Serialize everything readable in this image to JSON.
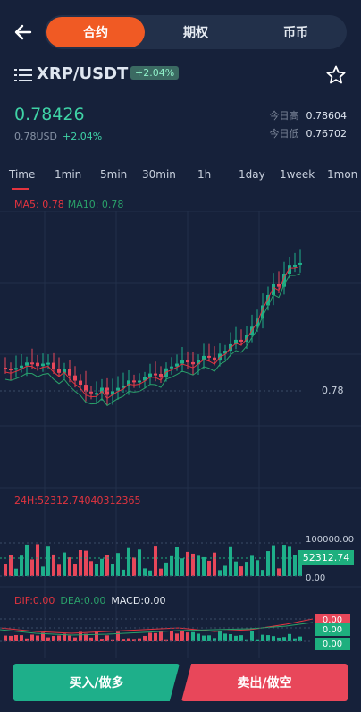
{
  "header": {
    "tabs": [
      {
        "label": "合约",
        "active": true
      },
      {
        "label": "期权",
        "active": false
      },
      {
        "label": "币币",
        "active": false
      }
    ],
    "back_icon": "back-arrow-icon"
  },
  "pair": {
    "name": "XRP/USDT",
    "change_badge": "+2.04%",
    "price": "0.78426",
    "price_usd": "0.78USD",
    "change_pct": "+2.04%",
    "high_label": "今日高",
    "high_value": "0.78604",
    "low_label": "今日低",
    "low_value": "0.76702"
  },
  "timeframes": [
    "Time",
    "1min",
    "5min",
    "30min",
    "1h",
    "1day",
    "1week",
    "1mon"
  ],
  "indicators": {
    "ma5": "MA5: 0.78",
    "ma10": "MA10: 0.78",
    "price_axis": "0.78",
    "h24": "24H:52312.74040312365",
    "vol_high": "100000.00",
    "vol_current": "52312.74",
    "vol_low": "0.00",
    "dif": "DIF:0.00",
    "dea": "DEA:0.00",
    "macd": "MACD:0.00",
    "macd_tags": [
      "0.00",
      "0.00",
      "0.00"
    ]
  },
  "actions": {
    "buy": "买入/做多",
    "sell": "卖出/做空"
  },
  "colors": {
    "up": "#1eaf8a",
    "down": "#e8475a",
    "accent": "#f05a24"
  }
}
